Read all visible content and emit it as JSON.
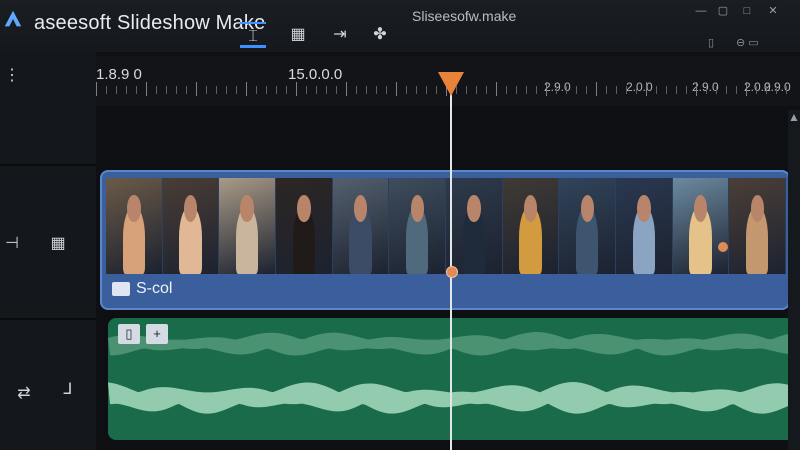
{
  "app": {
    "title": "aseesoft Slideshow Make",
    "window_title": "Sliseesofw.make"
  },
  "toolbar": {
    "tools": [
      {
        "name": "split-tool",
        "glyph": "⌶"
      },
      {
        "name": "layout-tool",
        "glyph": "▦"
      },
      {
        "name": "trim-tool",
        "glyph": "⇥"
      },
      {
        "name": "effects-tool",
        "glyph": "✤"
      }
    ],
    "active_tool": "split-tool"
  },
  "window_controls": {
    "minimize": "—",
    "restore": "▢",
    "maximize": "□",
    "close": "✕"
  },
  "ruler": {
    "labels": [
      "1.8.9 0",
      "15.0.0.0",
      "2.9.0",
      "2.0.0",
      "2.9.0",
      "2.0.0",
      "2.9.0"
    ]
  },
  "tracks": {
    "video": {
      "label": "S-col"
    },
    "audio": {
      "buttons": [
        "▯",
        "+"
      ]
    }
  },
  "colors": {
    "accent": "#3b93ff",
    "playhead": "#e8833a",
    "video_track": "#3a5f9c",
    "audio_track": "#1a6b4a",
    "waveform": "#a8dcbf"
  },
  "playhead": {
    "time": "15.0.0.0"
  }
}
